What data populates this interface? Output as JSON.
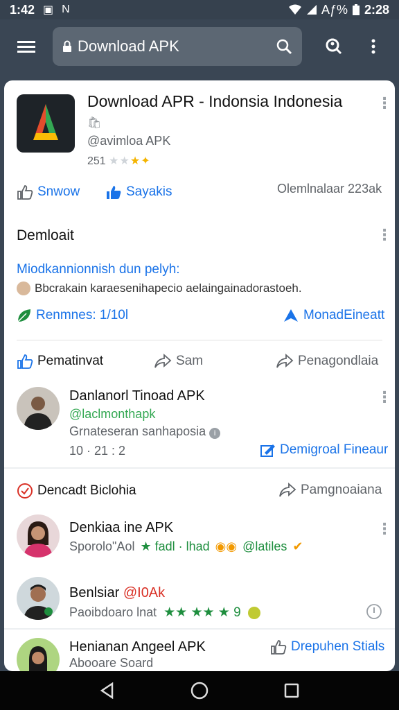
{
  "status_bar": {
    "time": "1:42",
    "icon_labels": [
      "▣",
      "N"
    ],
    "battery_text": "Aƒ%",
    "right_time": "2:28"
  },
  "toolbar": {
    "url": "Download APK"
  },
  "app": {
    "title": "Download APR - Indonsia Indonesia",
    "developer": "@avimloa APK",
    "rating_count": "251"
  },
  "actions": {
    "like": "Snwow",
    "saya": "Sayakis",
    "meta": "Olemlnalaar 223ak"
  },
  "description": {
    "title": "Demloait",
    "line1": "Miodkannionnish dun pelyh:",
    "line2": "Bbcrakain karaesenihapecio aelaingainadorastoeh.",
    "reviews_label": "Renmnes: 1/10l",
    "more_label": "MonadEineatt"
  },
  "reactions": {
    "like": "Pematinvat",
    "share": "Sam",
    "forward": "Penagondlaia"
  },
  "review1": {
    "name": "Danlanorl Tinoad APK",
    "handle": "@laclmonthapk",
    "sub": "Grnateseran sanhaposia",
    "date": "10 · 21 : 2",
    "action": "Demigroal Fineaur"
  },
  "section2": {
    "title": "Dencadt Biclohia",
    "share": "Pamgnoaiana"
  },
  "review2": {
    "name": "Denkiaa ine APK",
    "sub_prefix": "Sporolo\"Aol",
    "sub_mid": "★ fadl · lhad",
    "sub_suffix": "@latiles"
  },
  "review3": {
    "name": "Benlsiar",
    "name_tail": "@I0Ak",
    "sub": "Paoibdoaro lnat",
    "stars": "★★ ★★ ★ 9"
  },
  "review4": {
    "name": "Henianan Angeel APK",
    "sub": "Abooare Soard",
    "action": "Drepuhen Stials"
  },
  "colors": {
    "toolbar": "#3a4654",
    "accent": "#1a73e8",
    "green": "#1e8e3e",
    "red": "#d93025"
  }
}
